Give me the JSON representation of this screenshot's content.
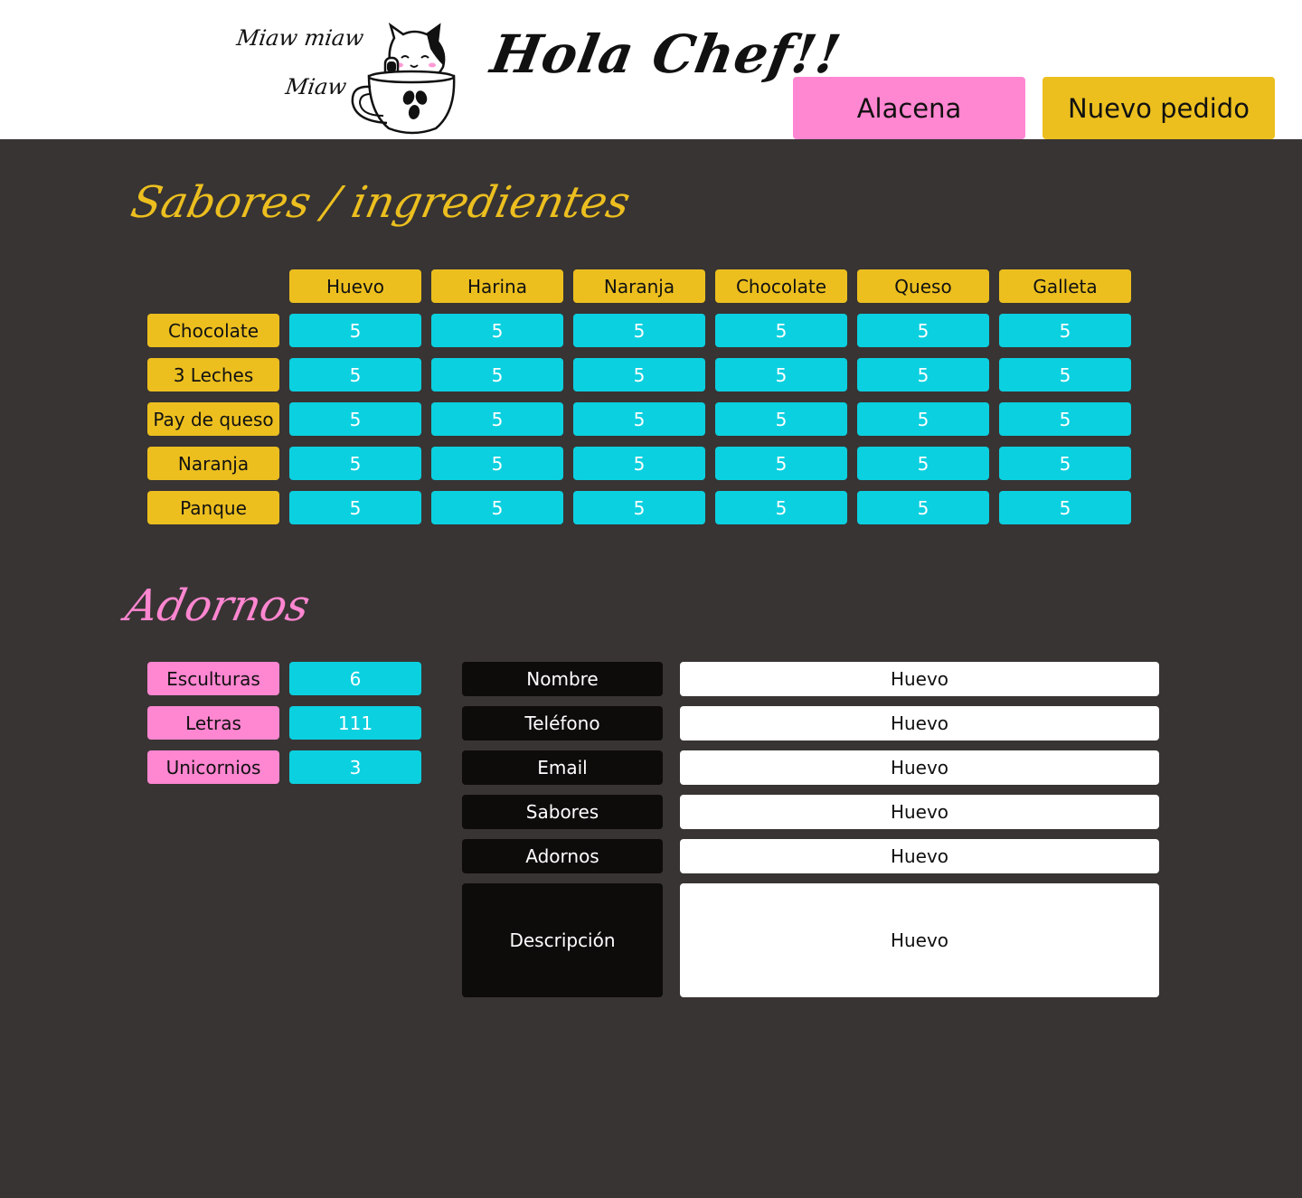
{
  "header": {
    "miaw_line1": "Miaw miaw",
    "miaw_line2": "Miaw",
    "greeting": "Hola Chef!!",
    "logo_icon": "cat-in-coffee-cup-icon",
    "nav": {
      "alacena_label": "Alacena",
      "nuevo_pedido_label": "Nuevo pedido"
    }
  },
  "colors": {
    "yellow": "#ecbf1f",
    "pink": "#ff86d1",
    "cyan": "#0bd0e0",
    "background": "#383433",
    "dark_label": "#0e0b0b"
  },
  "sabores": {
    "title": "Sabores / ingredientes",
    "columns": [
      "Huevo",
      "Harina",
      "Naranja",
      "Chocolate",
      "Queso",
      "Galleta"
    ],
    "rows": [
      {
        "label": "Chocolate",
        "values": [
          "5",
          "5",
          "5",
          "5",
          "5",
          "5"
        ]
      },
      {
        "label": "3 Leches",
        "values": [
          "5",
          "5",
          "5",
          "5",
          "5",
          "5"
        ]
      },
      {
        "label": "Pay de queso",
        "values": [
          "5",
          "5",
          "5",
          "5",
          "5",
          "5"
        ]
      },
      {
        "label": "Naranja",
        "values": [
          "5",
          "5",
          "5",
          "5",
          "5",
          "5"
        ]
      },
      {
        "label": "Panque",
        "values": [
          "5",
          "5",
          "5",
          "5",
          "5",
          "5"
        ]
      }
    ]
  },
  "adornos": {
    "title": "Adornos",
    "items": [
      {
        "label": "Esculturas",
        "value": "6"
      },
      {
        "label": "Letras",
        "value": "111"
      },
      {
        "label": "Unicornios",
        "value": "3"
      }
    ]
  },
  "pedido": {
    "fields": [
      {
        "label": "Nombre",
        "value": "Huevo"
      },
      {
        "label": "Teléfono",
        "value": "Huevo"
      },
      {
        "label": "Email",
        "value": "Huevo"
      },
      {
        "label": "Sabores",
        "value": "Huevo"
      },
      {
        "label": "Adornos",
        "value": "Huevo"
      },
      {
        "label": "Descripción",
        "value": "Huevo"
      }
    ]
  }
}
